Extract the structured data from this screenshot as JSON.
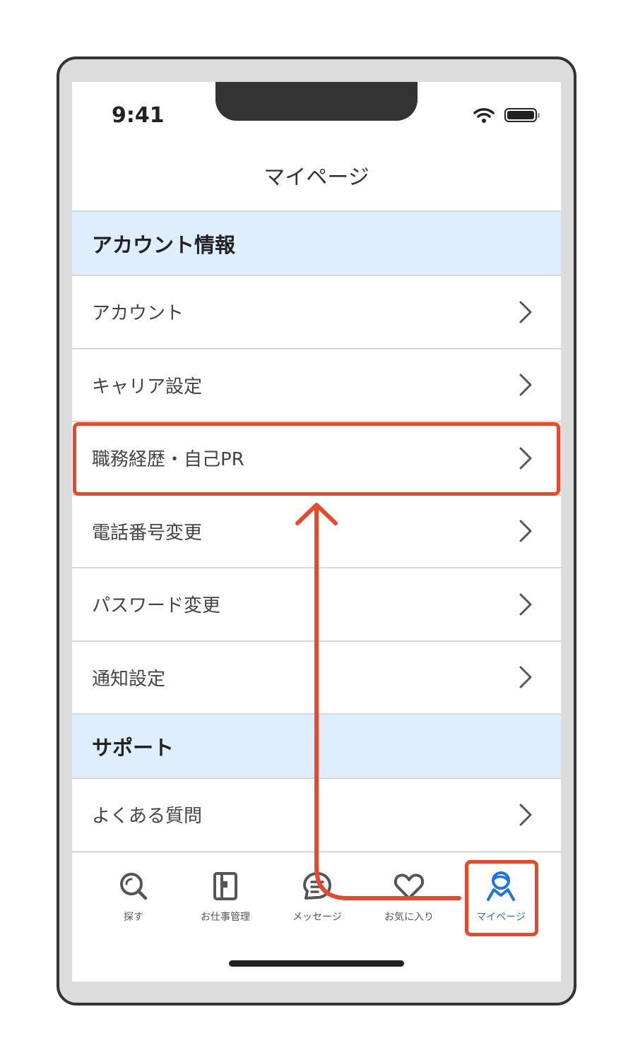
{
  "status_bar": {
    "time": "9:41"
  },
  "nav": {
    "title": "マイページ"
  },
  "sections": [
    {
      "header": "アカウント情報",
      "items": [
        {
          "label": "アカウント"
        },
        {
          "label": "キャリア設定"
        },
        {
          "label": "職務経歴・自己PR"
        },
        {
          "label": "電話番号変更"
        },
        {
          "label": "パスワード変更"
        },
        {
          "label": "通知設定"
        }
      ]
    },
    {
      "header": "サポート",
      "items": [
        {
          "label": "よくある質問"
        }
      ]
    }
  ],
  "tabs": [
    {
      "label": "探す",
      "icon": "search-icon"
    },
    {
      "label": "お仕事管理",
      "icon": "job-management-icon"
    },
    {
      "label": "メッセージ",
      "icon": "message-icon"
    },
    {
      "label": "お気に入り",
      "icon": "heart-icon"
    },
    {
      "label": "マイページ",
      "icon": "profile-icon",
      "active": true
    }
  ],
  "colors": {
    "accent": "#1a73e8",
    "annotation": "#e8492b",
    "section_bg": "#deeeff"
  }
}
